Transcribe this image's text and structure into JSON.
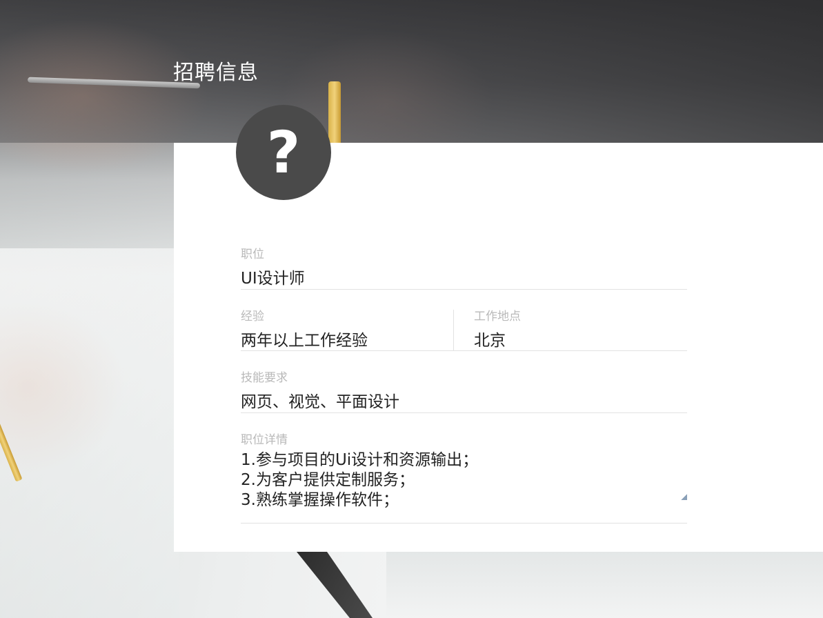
{
  "page": {
    "title": "招聘信息"
  },
  "avatar": {
    "icon": "question-mark-icon",
    "glyph": "?"
  },
  "form": {
    "position": {
      "label": "职位",
      "value": "UI设计师"
    },
    "experience": {
      "label": "经验",
      "value": "两年以上工作经验"
    },
    "location": {
      "label": "工作地点",
      "value": "北京"
    },
    "skills": {
      "label": "技能要求",
      "value": "网页、视觉、平面设计"
    },
    "details": {
      "label": "职位详情",
      "lines": [
        "1.参与项目的Ui设计和资源输出；",
        "2.为客户提供定制服务；",
        "3.熟练掌握操作软件；"
      ]
    }
  },
  "colors": {
    "avatar_bg": "#4a4a4a",
    "label": "#b9b9b9",
    "value": "#222222",
    "divider": "#e2e2e2"
  }
}
